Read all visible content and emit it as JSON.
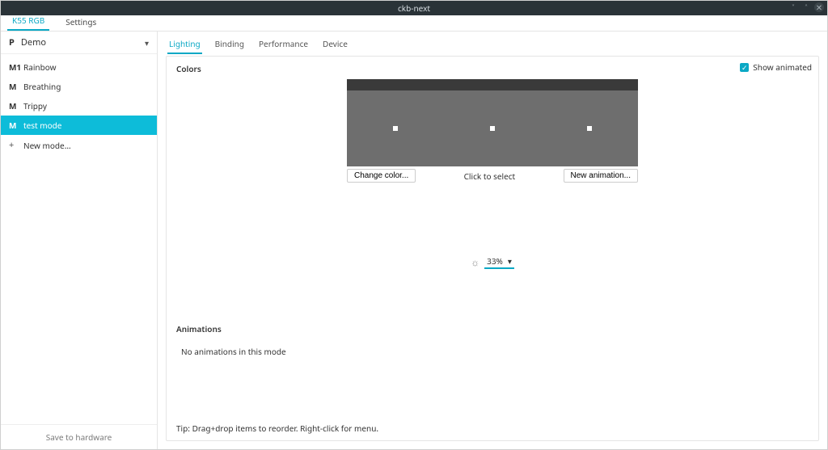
{
  "window": {
    "title": "ckb-next"
  },
  "tabbar": {
    "tabs": [
      {
        "label": "K55 RGB",
        "active": true
      },
      {
        "label": "Settings",
        "active": false
      }
    ]
  },
  "sidebar": {
    "profile_icon": "P",
    "profile_name": "Demo",
    "modes": [
      {
        "icon": "M1",
        "label": "Rainbow",
        "selected": false
      },
      {
        "icon": "M",
        "label": "Breathing",
        "selected": false
      },
      {
        "icon": "M",
        "label": "Trippy",
        "selected": false
      },
      {
        "icon": "M",
        "label": "test mode",
        "selected": true
      }
    ],
    "new_mode": "New mode...",
    "save_hw": "Save to hardware"
  },
  "subtabs": [
    {
      "label": "Lighting",
      "active": true
    },
    {
      "label": "Binding",
      "active": false
    },
    {
      "label": "Performance",
      "active": false
    },
    {
      "label": "Device",
      "active": false
    }
  ],
  "lighting": {
    "colors_title": "Colors",
    "show_animated": "Show animated",
    "change_color_btn": "Change color...",
    "click_hint": "Click to select",
    "new_anim_btn": "New animation...",
    "brightness_value": "33%",
    "animations_title": "Animations",
    "no_animations": "No animations in this mode",
    "tip": "Tip: Drag+drop items to reorder. Right-click for menu."
  }
}
